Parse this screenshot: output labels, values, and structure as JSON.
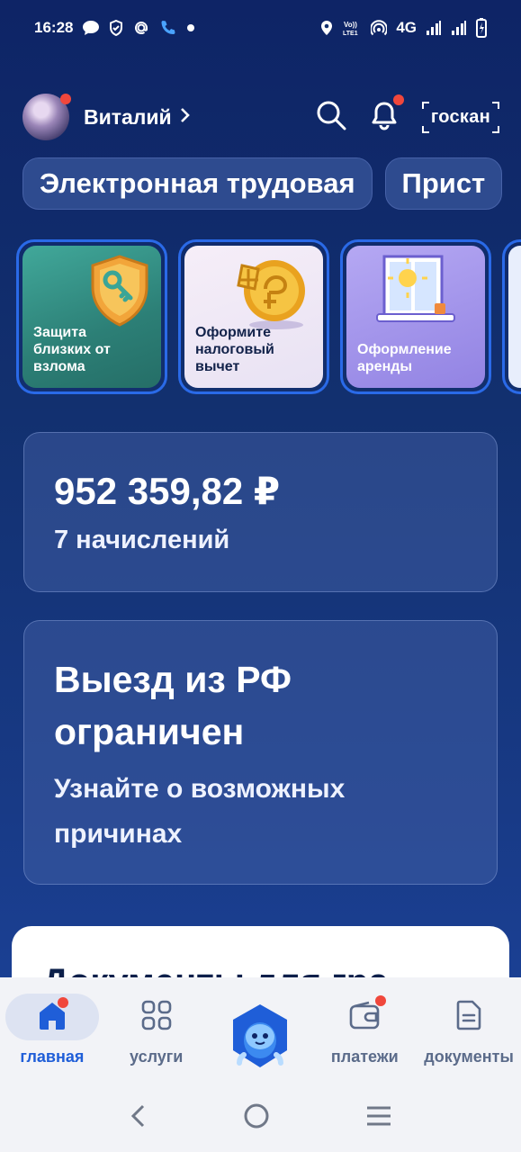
{
  "status_bar": {
    "time": "16:28",
    "network": "4G",
    "left_icons": [
      "chat-icon",
      "shield-icon",
      "at-icon",
      "phone-icon",
      "dot-icon"
    ],
    "right_icons": [
      "location-icon",
      "volte-icon",
      "hotspot-icon",
      "signal-icon",
      "signal-icon",
      "battery-icon"
    ]
  },
  "header": {
    "user_name": "Виталий",
    "goskan_label": "госкан"
  },
  "chips": [
    "Электронная трудовая",
    "Прист"
  ],
  "stories": [
    {
      "text": "Защита близких от взлома",
      "bg": "#2f8a7f"
    },
    {
      "text": "Оформите налоговый вычет",
      "bg": "#ece6f5"
    },
    {
      "text": "Оформление аренды",
      "bg": "#9a8ae6"
    }
  ],
  "accruals_card": {
    "amount": "952 359,82 ₽",
    "subtitle": "7 начислений"
  },
  "exit_card": {
    "title_line1": "Выезд из РФ",
    "title_line2": "ограничен",
    "subtitle_line1": "Узнайте о возможных",
    "subtitle_line2": "причинах"
  },
  "documents_sheet": {
    "title": "Документы для гра"
  },
  "bottom_nav": {
    "items": [
      {
        "label": "главная",
        "icon": "home-icon",
        "active": true
      },
      {
        "label": "услуги",
        "icon": "grid-icon",
        "active": false
      },
      {
        "label": "",
        "icon": "robot-icon",
        "active": false
      },
      {
        "label": "платежи",
        "icon": "wallet-icon",
        "active": false
      },
      {
        "label": "документы",
        "icon": "document-icon",
        "active": false
      }
    ]
  },
  "colors": {
    "accent": "#1f5ed8",
    "notification": "#f0473c",
    "background_top": "#0e2466"
  }
}
